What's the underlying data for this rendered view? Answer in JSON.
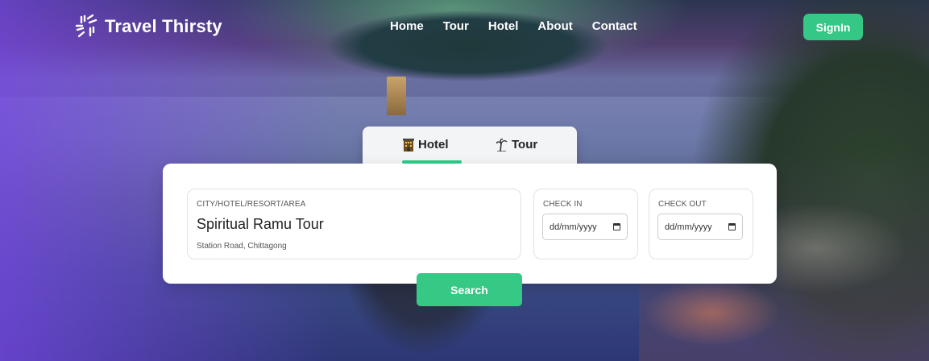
{
  "nav": {
    "brand": "Travel Thirsty",
    "items": [
      {
        "label": "Home"
      },
      {
        "label": "Tour"
      },
      {
        "label": "Hotel"
      },
      {
        "label": "About"
      },
      {
        "label": "Contact"
      }
    ],
    "signin_label": "SignIn"
  },
  "tabs": [
    {
      "label": "Hotel",
      "icon": "hotel-building-icon",
      "active": true
    },
    {
      "label": "Tour",
      "icon": "palm-tree-icon",
      "active": false
    }
  ],
  "search": {
    "location": {
      "label": "CITY/HOTEL/RESORT/AREA",
      "title": "Spiritual Ramu Tour",
      "subtitle": "Station Road, Chittagong"
    },
    "check_in": {
      "label": "CHECK IN",
      "placeholder": "dd/mm/yyyy"
    },
    "check_out": {
      "label": "CHECK OUT",
      "placeholder": "dd/mm/yyyy"
    },
    "button_label": "Search"
  },
  "colors": {
    "accent": "#34c785",
    "card": "#ffffff",
    "tab_bg": "#f3f4f6"
  }
}
